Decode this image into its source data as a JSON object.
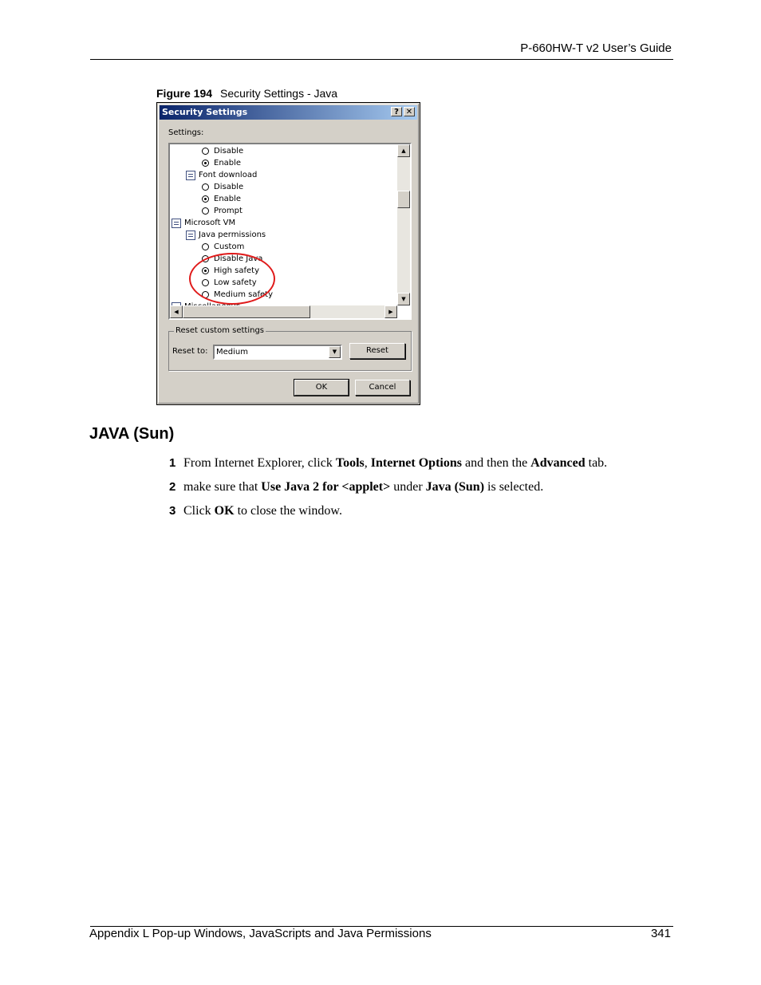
{
  "header": {
    "title": "P-660HW-T v2 User’s Guide"
  },
  "figure": {
    "number": "Figure 194",
    "caption": "Security Settings - Java"
  },
  "dialog": {
    "title": "Security Settings",
    "help_button": "?",
    "close_button": "✕",
    "settings_label": "Settings:",
    "tree_items": [
      {
        "kind": "radio",
        "label": "Disable",
        "checked": false
      },
      {
        "kind": "radio",
        "label": "Enable",
        "checked": true
      },
      {
        "kind": "folder",
        "label": "Font download"
      },
      {
        "kind": "radio",
        "label": "Disable",
        "checked": false
      },
      {
        "kind": "radio",
        "label": "Enable",
        "checked": true
      },
      {
        "kind": "radio",
        "label": "Prompt",
        "checked": false
      },
      {
        "kind": "folder",
        "label": "Microsoft VM"
      },
      {
        "kind": "folder",
        "label": "Java permissions"
      },
      {
        "kind": "radio",
        "label": "Custom",
        "checked": false
      },
      {
        "kind": "radio",
        "label": "Disable Java",
        "checked": false
      },
      {
        "kind": "radio",
        "label": "High safety",
        "checked": true
      },
      {
        "kind": "radio",
        "label": "Low safety",
        "checked": false
      },
      {
        "kind": "radio",
        "label": "Medium safety",
        "checked": false
      },
      {
        "kind": "folder",
        "label": "Miscellaneous"
      }
    ],
    "reset_group_label": "Reset custom settings",
    "reset_to_label": "Reset to:",
    "reset_to_value": "Medium",
    "reset_button": "Reset",
    "ok_button": "OK",
    "cancel_button": "Cancel"
  },
  "section": {
    "heading": "JAVA (Sun)",
    "steps": [
      {
        "num": "1",
        "parts": [
          {
            "t": "From Internet Explorer, click ",
            "b": false
          },
          {
            "t": "Tools",
            "b": true
          },
          {
            "t": ", ",
            "b": false
          },
          {
            "t": "Internet Options",
            "b": true
          },
          {
            "t": " and then the ",
            "b": false
          },
          {
            "t": "Advanced",
            "b": true
          },
          {
            "t": " tab.",
            "b": false
          }
        ]
      },
      {
        "num": "2",
        "parts": [
          {
            "t": "make sure that ",
            "b": false
          },
          {
            "t": "Use Java 2 for <applet>",
            "b": true
          },
          {
            "t": " under ",
            "b": false
          },
          {
            "t": "Java (Sun)",
            "b": true
          },
          {
            "t": " is selected.",
            "b": false
          }
        ]
      },
      {
        "num": "3",
        "parts": [
          {
            "t": "Click ",
            "b": false
          },
          {
            "t": "OK",
            "b": true
          },
          {
            "t": " to close the window.",
            "b": false
          }
        ]
      }
    ]
  },
  "footer": {
    "left": "Appendix L Pop-up Windows, JavaScripts and Java Permissions",
    "right": "341"
  }
}
